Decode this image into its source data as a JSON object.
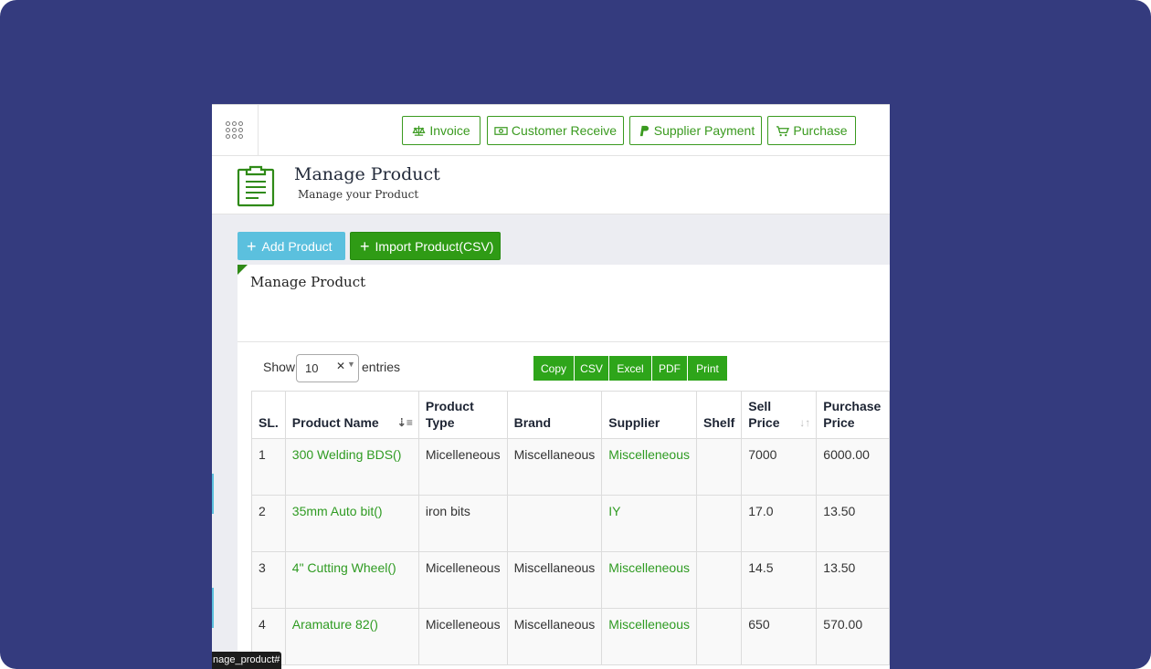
{
  "colors": {
    "background": "#343b7e",
    "accent_green": "#2ea51a",
    "info_blue": "#5bc0de"
  },
  "topbar": {
    "apps_icon": "grid-dots-icon",
    "quick_buttons": [
      {
        "label": "Invoice",
        "icon": "balance-scale-icon"
      },
      {
        "label": "Customer Receive",
        "icon": "money-bill-icon"
      },
      {
        "label": "Supplier Payment",
        "icon": "paypal-icon"
      },
      {
        "label": "Purchase",
        "icon": "cart-icon"
      }
    ]
  },
  "header": {
    "icon": "clipboard-icon",
    "title": "Manage Product",
    "subtitle": "Manage your Product"
  },
  "actions": {
    "add_product": "Add Product",
    "import_product": "Import Product(CSV)"
  },
  "panel": {
    "title": "Manage Product",
    "show_label": "Show",
    "entries_value": "10",
    "entries_label": "entries",
    "export_buttons": [
      "Copy",
      "CSV",
      "Excel",
      "PDF",
      "Print"
    ]
  },
  "table": {
    "headers": {
      "sl": "SL.",
      "product_name": "Product Name",
      "product_type": [
        "Product",
        "Type"
      ],
      "brand": "Brand",
      "supplier": "Supplier",
      "shelf": "Shelf",
      "sell_price": [
        "Sell",
        "Price"
      ],
      "purchase_price": [
        "Purchase",
        "Price"
      ]
    },
    "rows": [
      {
        "sl": "1",
        "name": "300 Welding BDS()",
        "type": "Micelleneous",
        "brand": "Miscellaneous",
        "supplier": "Miscelleneous",
        "shelf": "",
        "sell": "7000",
        "purchase": "6000.00"
      },
      {
        "sl": "2",
        "name": "35mm Auto bit()",
        "type": "iron bits",
        "brand": "",
        "supplier": "IY",
        "shelf": "",
        "sell": "17.0",
        "purchase": "13.50"
      },
      {
        "sl": "3",
        "name": "4\" Cutting Wheel()",
        "type": "Micelleneous",
        "brand": "Miscellaneous",
        "supplier": "Miscelleneous",
        "shelf": "",
        "sell": "14.5",
        "purchase": "13.50"
      },
      {
        "sl": "4",
        "name": "Aramature 82()",
        "type": "Micelleneous",
        "brand": "Miscellaneous",
        "supplier": "Miscelleneous",
        "shelf": "",
        "sell": "650",
        "purchase": "570.00"
      }
    ]
  },
  "statusbar": {
    "url": "nage_product#"
  }
}
